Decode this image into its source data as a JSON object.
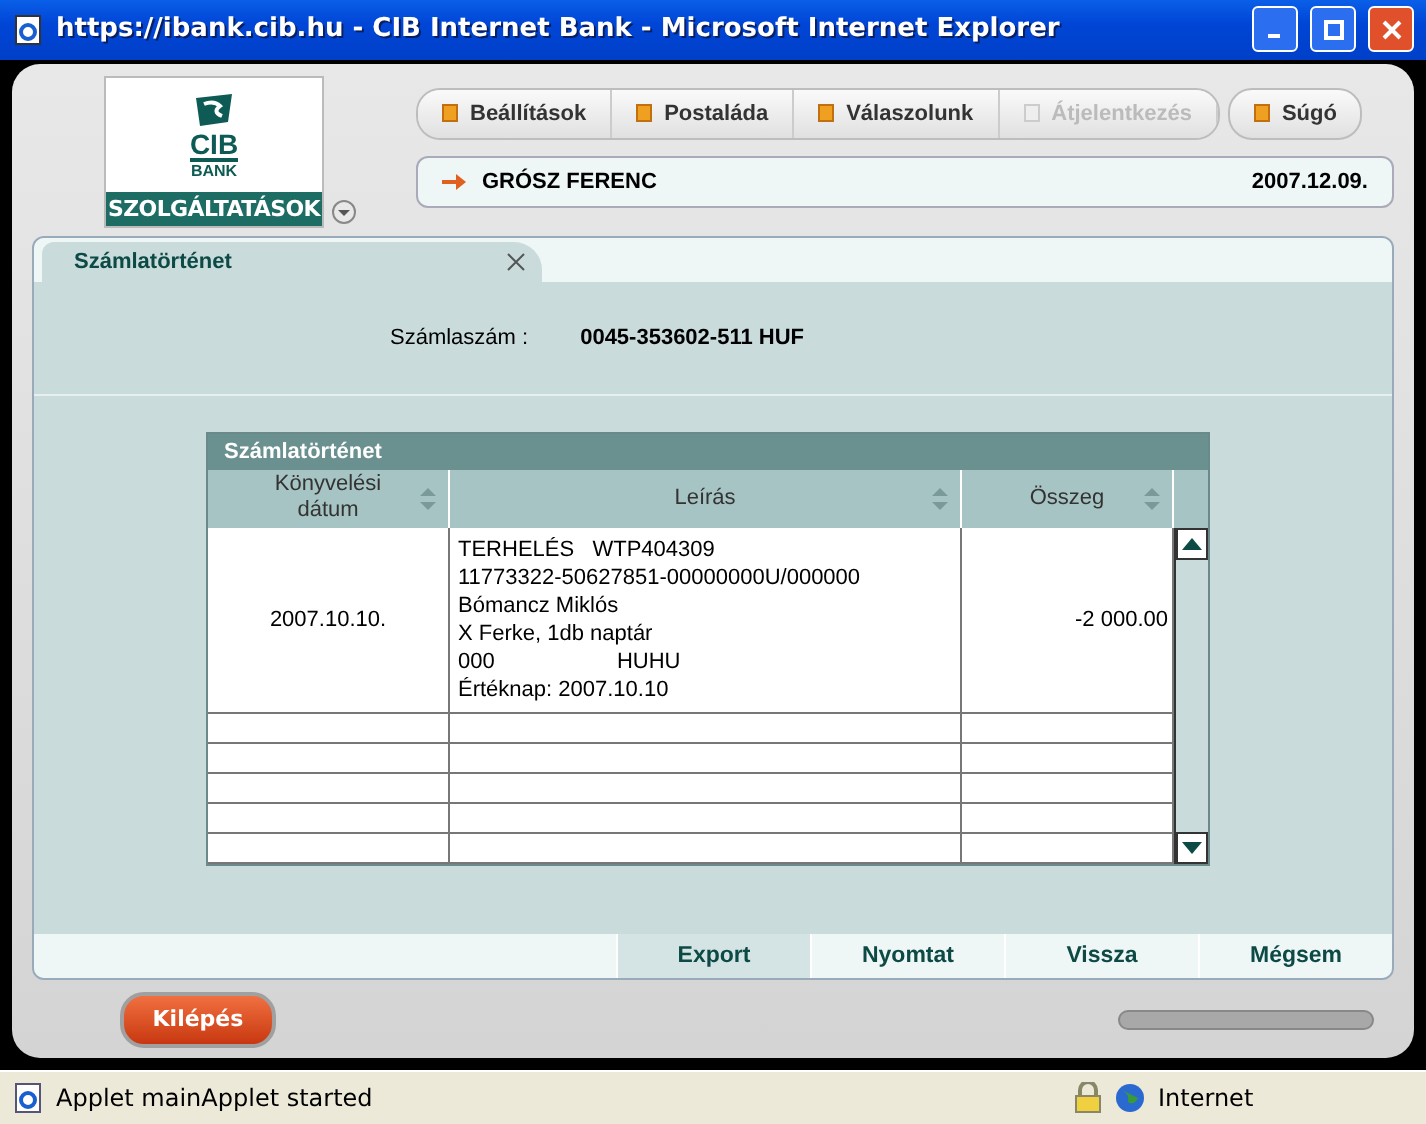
{
  "window": {
    "title": "https://ibank.cib.hu - CIB Internet Bank - Microsoft Internet Explorer"
  },
  "logo": {
    "brand": "CIB",
    "sub": "BANK",
    "menu": "SZOLGÁLTATÁSOK"
  },
  "nav_buttons": [
    {
      "label": "Beállítások",
      "disabled": false
    },
    {
      "label": "Postaláda",
      "disabled": false
    },
    {
      "label": "Válaszolunk",
      "disabled": false
    },
    {
      "label": "Átjelentkezés",
      "disabled": true
    },
    {
      "label": "Súgó",
      "disabled": false
    }
  ],
  "user": {
    "name": "GRÓSZ FERENC",
    "date": "2007.12.09."
  },
  "tabs": [
    {
      "label": "Számlatörténet",
      "selected": true
    }
  ],
  "account": {
    "label": "Számlaszám :",
    "value": "0045-353602-511 HUF"
  },
  "table": {
    "title": "Számlatörténet",
    "columns": [
      "Könyvelési dátum",
      "Leírás",
      "Összeg"
    ],
    "rows": [
      {
        "date": "2007.10.10.",
        "description": [
          "TERHELÉS   WTP404309",
          "11773322-50627851-00000000U/000000",
          "Bómancz Miklós",
          "X Ferke, 1db naptár",
          "000                    HUHU",
          "Értéknap: 2007.10.10"
        ],
        "amount": "-2 000.00"
      }
    ]
  },
  "actions": [
    {
      "label": "Export",
      "selected": true
    },
    {
      "label": "Nyomtat",
      "selected": false
    },
    {
      "label": "Vissza",
      "selected": false
    },
    {
      "label": "Mégsem",
      "selected": false
    }
  ],
  "exit_button": "Kilépés",
  "status_bar": {
    "text": "Applet mainApplet started",
    "zone": "Internet"
  }
}
